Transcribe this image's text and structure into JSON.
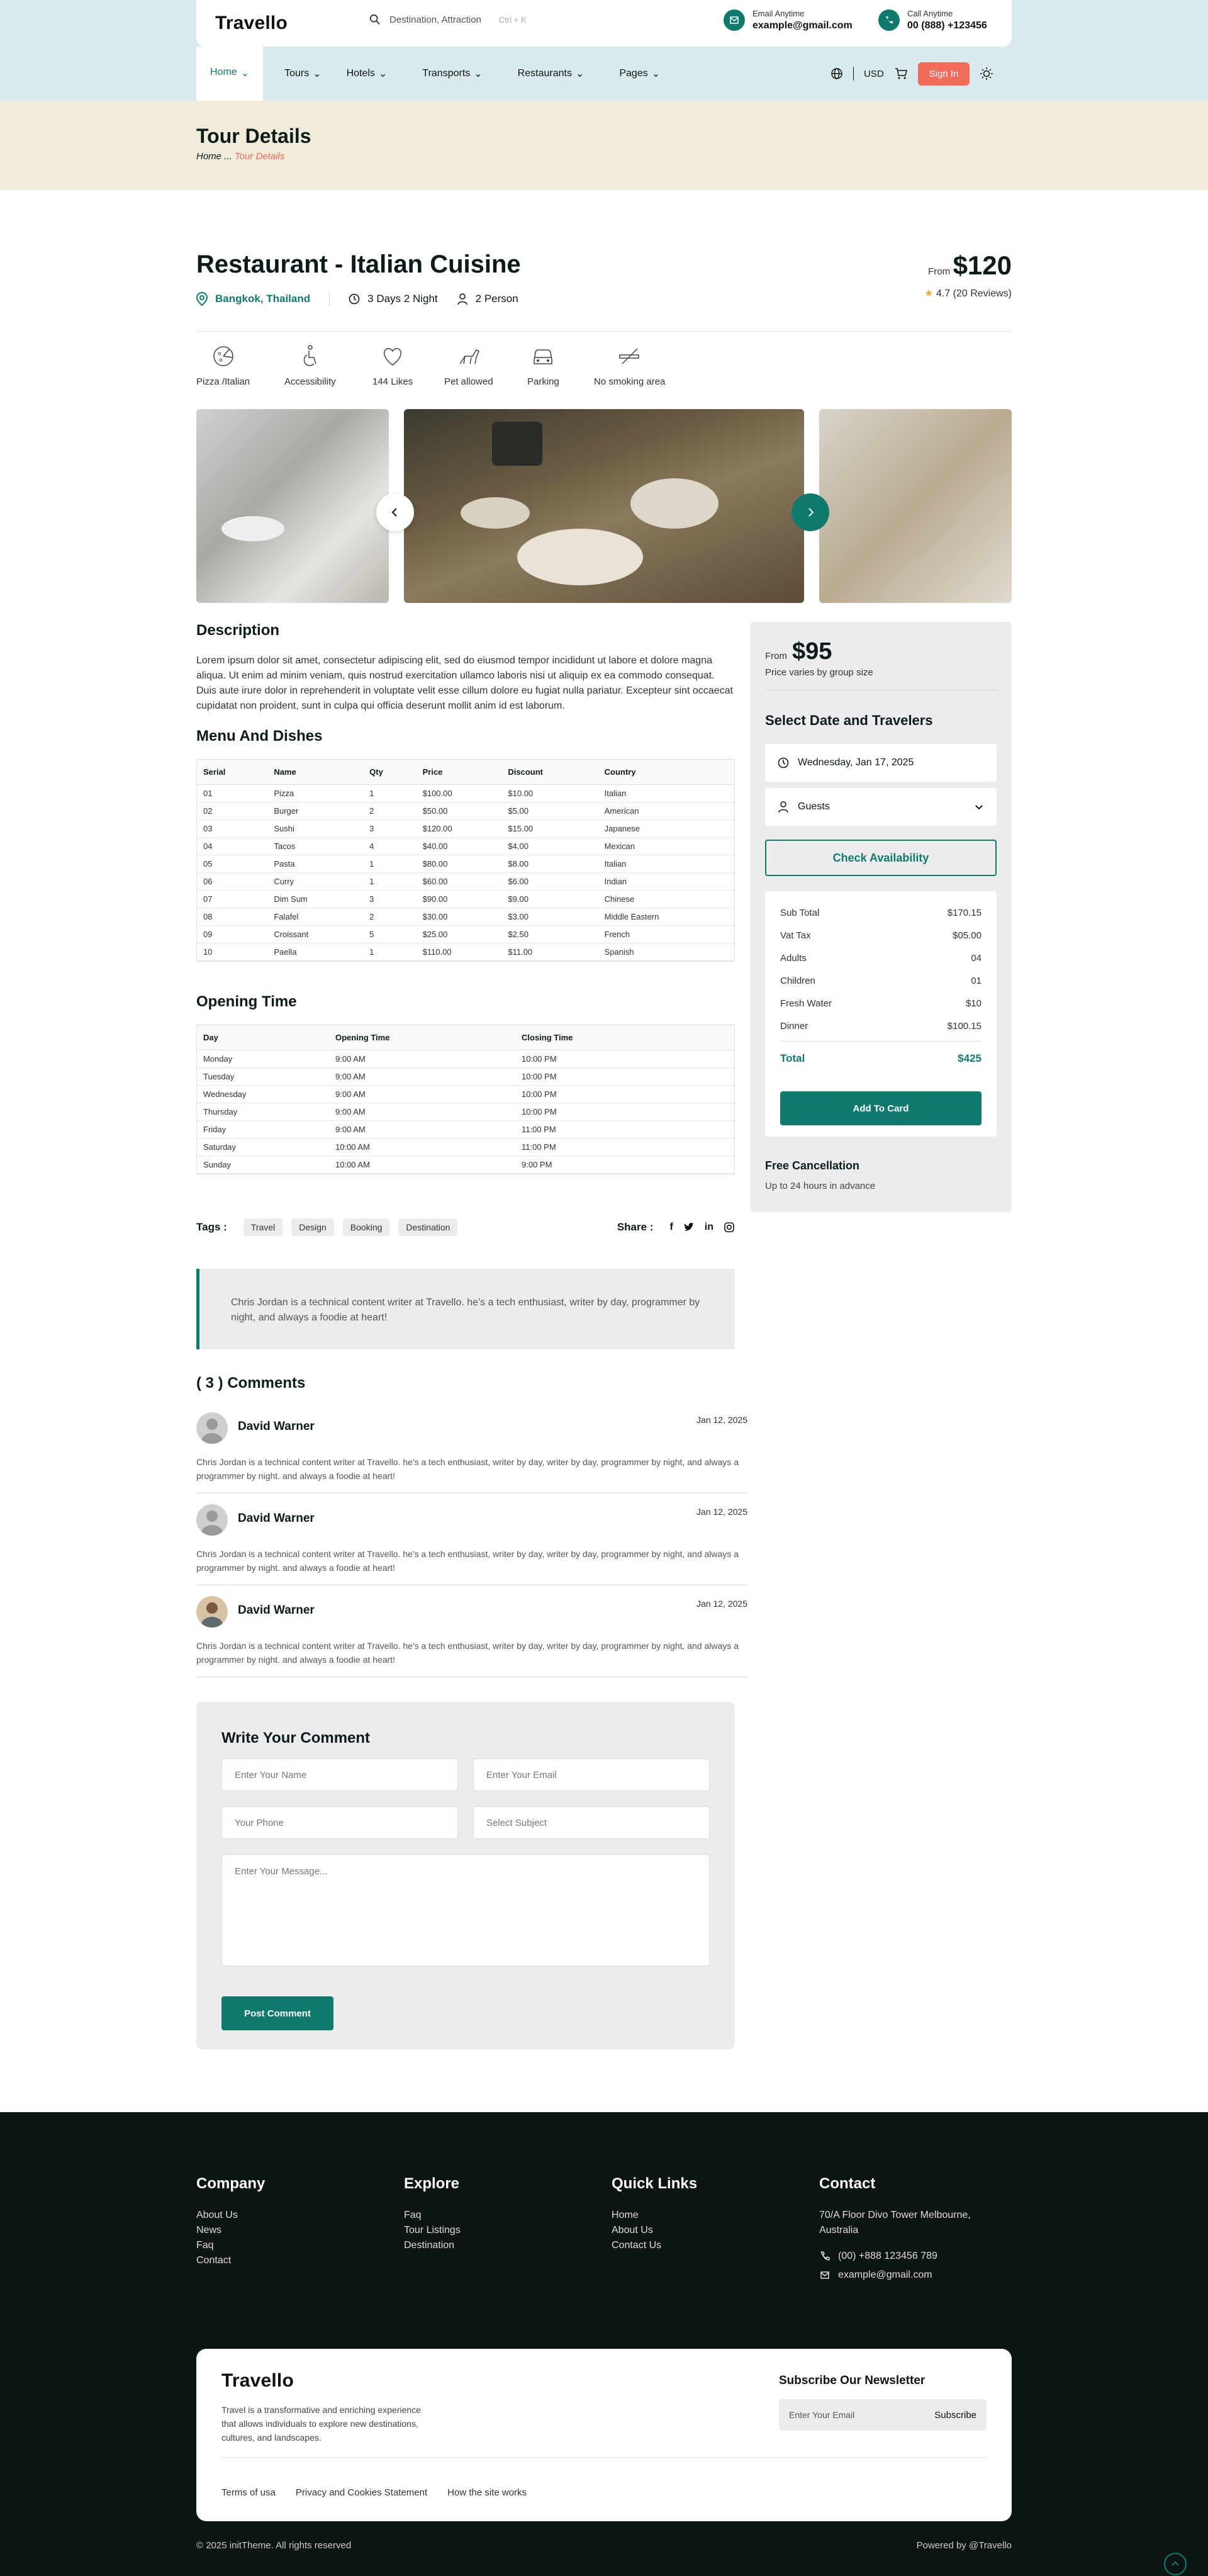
{
  "header": {
    "logo": "Travello",
    "search_placeholder": "Destination, Attraction",
    "search_shortcut": "Ctrl + K",
    "email_label": "Email Anytime",
    "email_value": "example@gmail.com",
    "call_label": "Call Anytime",
    "call_value": "00 (888) +123456",
    "nav": [
      "Home",
      "Tours",
      "Hotels",
      "Transports",
      "Restaurants",
      "Pages"
    ],
    "currency": "USD",
    "signin": "Sign In"
  },
  "band": {
    "title": "Tour Details",
    "crumb_home": "Home",
    "crumb_sep": "...",
    "crumb_current": "Tour Details"
  },
  "listing": {
    "title": "Restaurant - Italian Cuisine",
    "location": "Bangkok, Thailand",
    "duration": "3 Days 2 Night",
    "persons": "2 Person",
    "price_from": "From",
    "price": "$120",
    "rating": "4.7 (20 Reviews)"
  },
  "amenities": [
    "Pizza /Italian",
    "Accessibility",
    "144 Likes",
    "Pet allowed",
    "Parking",
    "No smoking area"
  ],
  "description": {
    "heading": "Description",
    "text": "Lorem ipsum dolor sit amet, consectetur adipiscing elit, sed do eiusmod tempor incididunt ut labore et dolore magna aliqua. Ut enim ad minim veniam, quis nostrud exercitation ullamco laboris nisi ut aliquip ex ea commodo consequat. Duis aute irure dolor in reprehenderit in voluptate velit esse cillum dolore eu fugiat nulla pariatur. Excepteur sint occaecat cupidatat non proident, sunt in culpa qui officia deserunt mollit anim id est laborum."
  },
  "menu": {
    "heading": "Menu And Dishes",
    "columns": [
      "Serial",
      "Name",
      "Qty",
      "Price",
      "Discount",
      "Country"
    ],
    "rows": [
      [
        "01",
        "Pizza",
        "1",
        "$100.00",
        "$10.00",
        "Italian"
      ],
      [
        "02",
        "Burger",
        "2",
        "$50.00",
        "$5.00",
        "American"
      ],
      [
        "03",
        "Sushi",
        "3",
        "$120.00",
        "$15.00",
        "Japanese"
      ],
      [
        "04",
        "Tacos",
        "4",
        "$40.00",
        "$4.00",
        "Mexican"
      ],
      [
        "05",
        "Pasta",
        "1",
        "$80.00",
        "$8.00",
        "Italian"
      ],
      [
        "06",
        "Curry",
        "1",
        "$60.00",
        "$6.00",
        "Indian"
      ],
      [
        "07",
        "Dim Sum",
        "3",
        "$90.00",
        "$9.00",
        "Chinese"
      ],
      [
        "08",
        "Falafel",
        "2",
        "$30.00",
        "$3.00",
        "Middle Eastern"
      ],
      [
        "09",
        "Croissant",
        "5",
        "$25.00",
        "$2.50",
        "French"
      ],
      [
        "10",
        "Paella",
        "1",
        "$110.00",
        "$11.00",
        "Spanish"
      ]
    ]
  },
  "opening": {
    "heading": "Opening Time",
    "columns": [
      "Day",
      "Opening Time",
      "Closing Time"
    ],
    "rows": [
      [
        "Monday",
        "9:00 AM",
        "10:00 PM"
      ],
      [
        "Tuesday",
        "9:00 AM",
        "10:00 PM"
      ],
      [
        "Wednesday",
        "9:00 AM",
        "10:00 PM"
      ],
      [
        "Thursday",
        "9:00 AM",
        "10:00 PM"
      ],
      [
        "Friday",
        "9:00 AM",
        "11:00 PM"
      ],
      [
        "Saturday",
        "10:00 AM",
        "11:00 PM"
      ],
      [
        "Sunday",
        "10:00 AM",
        "9:00 PM"
      ]
    ]
  },
  "tags": {
    "label": "Tags :",
    "items": [
      "Travel",
      "Design",
      "Booking",
      "Destination"
    ],
    "share_label": "Share :"
  },
  "quote": "Chris Jordan is a technical content writer at Travello. he's a tech enthusiast, writer by day, programmer by night, and always a foodie at heart!",
  "comments": {
    "heading": "( 3 ) Comments",
    "items": [
      {
        "name": "David Warner",
        "date": "Jan 12, 2025",
        "text": "Chris Jordan is a technical content writer at Travello. he's a tech enthusiast, writer by day, writer by day, programmer by night, and always a programmer by night. and always a foodie at heart!"
      },
      {
        "name": "David Warner",
        "date": "Jan 12, 2025",
        "text": "Chris Jordan is a technical content writer at Travello. he's a tech enthusiast, writer by day, writer by day, programmer by night, and always a programmer by night. and always a foodie at heart!"
      },
      {
        "name": "David Warner",
        "date": "Jan 12, 2025",
        "text": "Chris Jordan is a technical content writer at Travello. he's a tech enthusiast, writer by day, writer by day, programmer by night, and always a programmer by night. and always a foodie at heart!"
      }
    ]
  },
  "form": {
    "heading": "Write Your Comment",
    "name_ph": "Enter Your Name",
    "email_ph": "Enter Your Email",
    "phone_ph": "Your Phone",
    "subject_ph": "Select Subject",
    "message_ph": "Enter Your Message...",
    "submit": "Post Comment"
  },
  "sidebar": {
    "from": "From",
    "price": "$95",
    "note": "Price varies by group size",
    "heading": "Select Date and Travelers",
    "date": "Wednesday, Jan 17, 2025",
    "guests": "Guests",
    "check": "Check Availability",
    "summary": [
      [
        "Sub Total",
        "$170.15"
      ],
      [
        "Vat Tax",
        "$05.00"
      ],
      [
        "Adults",
        "04"
      ],
      [
        "Children",
        "01"
      ],
      [
        "Fresh Water",
        "$10"
      ],
      [
        "Dinner",
        "$100.15"
      ]
    ],
    "total_label": "Total",
    "total": "$425",
    "add": "Add To Card",
    "cancel_title": "Free Cancellation",
    "cancel_text": "Up to 24 hours in advance"
  },
  "footer": {
    "company": {
      "title": "Company",
      "links": [
        "About Us",
        "News",
        "Faq",
        "Contact"
      ]
    },
    "explore": {
      "title": "Explore",
      "links": [
        "Faq",
        "Tour Listings",
        "Destination"
      ]
    },
    "quick": {
      "title": "Quick Links",
      "links": [
        "Home",
        "About Us",
        "Contact Us"
      ]
    },
    "contact": {
      "title": "Contact",
      "address": "70/A Floor Divo Tower Melbourne, Australia",
      "phone": "(00) +888 123456 789",
      "email": "example@gmail.com"
    },
    "logo": "Travello",
    "about": "Travel is a transformative and enriching experience that allows individuals to explore new destinations, cultures, and landscapes.",
    "newsletter_title": "Subscribe Our Newsletter",
    "newsletter_ph": "Enter Your Email",
    "subscribe": "Subscribe",
    "legal": [
      "Terms of usa",
      "Privacy and Cookies Statement",
      "How the site works"
    ],
    "copyright": "© 2025 initTheme. All rights reserved",
    "powered": "Powered by @Travello"
  },
  "colors": {
    "accent": "#0f7a6c",
    "coral": "#f36b5b",
    "header_bg": "#d9ebec",
    "band_bg": "#f0ecd9",
    "footer_bg": "#0c1414"
  }
}
